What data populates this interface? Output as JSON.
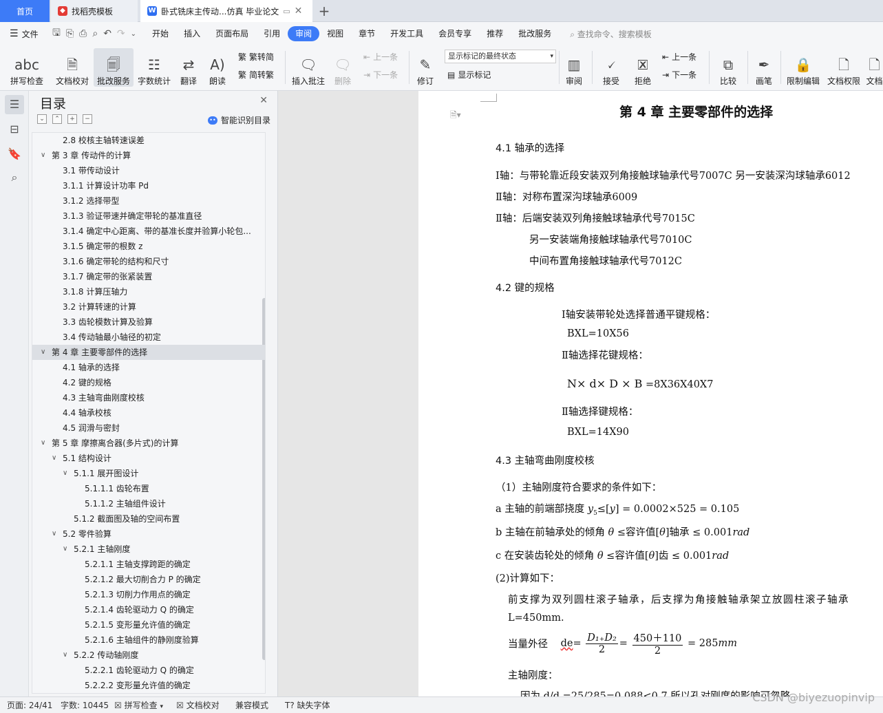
{
  "tabs": {
    "home": "首页",
    "templates": "找稻壳模板",
    "document": "卧式铣床主传动...仿真 毕业论文",
    "add": "+"
  },
  "menu": {
    "file": "文件",
    "items": [
      "开始",
      "插入",
      "页面布局",
      "引用",
      "审阅",
      "视图",
      "章节",
      "开发工具",
      "会员专享",
      "推荐",
      "批改服务"
    ],
    "active": "审阅",
    "search": "查找命令、搜索模板"
  },
  "ribbon": {
    "spellcheck": "拼写检查",
    "doc_proof": "文档校对",
    "correction_service": "批改服务",
    "word_count": "字数统计",
    "translate": "翻译",
    "read_aloud": "朗读",
    "trad_convert": "繁转简",
    "simp_convert": "简转繁",
    "insert_comment": "插入批注",
    "delete": "删除",
    "prev_comment": "上一条",
    "next_comment": "下一条",
    "revise": "修订",
    "markup_state": "显示标记的最终状态",
    "show_markup": "显示标记",
    "review": "审阅",
    "accept": "接受",
    "reject": "拒绝",
    "prev_change": "上一条",
    "next_change": "下一条",
    "compare": "比较",
    "ink": "画笔",
    "restrict_edit": "限制编辑",
    "doc_permission": "文档权限",
    "doc_more": "文档"
  },
  "toc": {
    "title": "目录",
    "smart_toc": "智能识别目录",
    "items": [
      {
        "text": "2.8 校核主轴转速误差",
        "level": 2,
        "chev": false
      },
      {
        "text": "第 3 章  传动件的计算",
        "level": 1,
        "chev": true
      },
      {
        "text": "3.1  带传动设计",
        "level": 2,
        "chev": false
      },
      {
        "text": "3.1.1 计算设计功率 Pd",
        "level": 2,
        "chev": false
      },
      {
        "text": "3.1.2 选择带型",
        "level": 2,
        "chev": false
      },
      {
        "text": "3.1.3 验证带速并确定带轮的基准直径",
        "level": 2,
        "chev": false
      },
      {
        "text": "3.1.4 确定中心距离、带的基准长度并验算小轮包...",
        "level": 2,
        "chev": false
      },
      {
        "text": "3.1.5 确定带的根数 z",
        "level": 2,
        "chev": false
      },
      {
        "text": "3.1.6 确定带轮的结构和尺寸",
        "level": 2,
        "chev": false
      },
      {
        "text": "3.1.7 确定带的张紧装置",
        "level": 2,
        "chev": false
      },
      {
        "text": "3.1.8 计算压轴力",
        "level": 2,
        "chev": false
      },
      {
        "text": "3.2  计算转速的计算",
        "level": 2,
        "chev": false
      },
      {
        "text": "3.3  齿轮模数计算及验算",
        "level": 2,
        "chev": false
      },
      {
        "text": "3.4  传动轴最小轴径的初定",
        "level": 2,
        "chev": false
      },
      {
        "text": "第 4 章  主要零部件的选择",
        "level": 1,
        "chev": true,
        "selected": true
      },
      {
        "text": "4.1  轴承的选择",
        "level": 2,
        "chev": false
      },
      {
        "text": "4.2  键的规格",
        "level": 2,
        "chev": false
      },
      {
        "text": "4.3  主轴弯曲刚度校核",
        "level": 2,
        "chev": false
      },
      {
        "text": "4.4  轴承校核",
        "level": 2,
        "chev": false
      },
      {
        "text": "4.5  润滑与密封",
        "level": 2,
        "chev": false
      },
      {
        "text": "第 5 章    摩擦离合器(多片式)的计算",
        "level": 1,
        "chev": true
      },
      {
        "text": "5.1  结构设计",
        "level": 2,
        "chev": true
      },
      {
        "text": "5.1.1  展开图设计",
        "level": 3,
        "chev": true
      },
      {
        "text": "5.1.1.1  齿轮布置",
        "level": 4,
        "chev": false
      },
      {
        "text": "5.1.1.2  主轴组件设计",
        "level": 4,
        "chev": false
      },
      {
        "text": "5.1.2  截面图及轴的空间布置",
        "level": 3,
        "chev": false
      },
      {
        "text": "5.2  零件验算",
        "level": 2,
        "chev": true
      },
      {
        "text": "5.2.1  主轴刚度",
        "level": 3,
        "chev": true
      },
      {
        "text": "5.2.1.1  主轴支撑跨距的确定",
        "level": 4,
        "chev": false
      },
      {
        "text": "5.2.1.2  最大切削合力 P 的确定",
        "level": 4,
        "chev": false
      },
      {
        "text": "5.2.1.3  切削力作用点的确定",
        "level": 4,
        "chev": false
      },
      {
        "text": "5.2.1.4  齿轮驱动力 Q 的确定",
        "level": 4,
        "chev": false
      },
      {
        "text": "5.2.1.5  变形量允许值的确定",
        "level": 4,
        "chev": false
      },
      {
        "text": "5.2.1.6  主轴组件的静刚度验算",
        "level": 4,
        "chev": false
      },
      {
        "text": "5.2.2  传动轴刚度",
        "level": 3,
        "chev": true
      },
      {
        "text": "5.2.2.1  齿轮驱动力 Q 的确定",
        "level": 4,
        "chev": false
      },
      {
        "text": "5.2.2.2  变形量允许值的确定",
        "level": 4,
        "chev": false
      }
    ]
  },
  "doc": {
    "chapter_title": "第 4 章  主要零部件的选择",
    "s41": "4.1  轴承的选择",
    "l1": "Ⅰ轴：与带轮靠近段安装双列角接触球轴承代号7007C  另一安装深沟球轴承6012",
    "l2": "Ⅱ轴：对称布置深沟球轴承6009",
    "l3": "Ⅱ轴：后端安装双列角接触球轴承代号7015C",
    "l4": "另一安装端角接触球轴承代号7010C",
    "l5": "中间布置角接触球轴承代号7012C",
    "s42": "4.2  键的规格",
    "k1": "Ⅰ轴安装带轮处选择普通平键规格：",
    "k2": "BXL=10X56",
    "k3": "Ⅱ轴选择花键规格：",
    "k4a": "N× d× D × B",
    "k4b": "=8X36X40X7",
    "k5": "Ⅱ轴选择键规格：",
    "k6": "BXL=14X90",
    "s43": "4.3  主轴弯曲刚度校核",
    "c1": "（1）主轴刚度符合要求的条件如下：",
    "c2a": "a 主轴的前端部挠度 ",
    "c2b": "y",
    "c2c": "≤[",
    "c2d": "y",
    "c2e": "] = 0.0002×525 = 0.105",
    "c3a": "b 主轴在前轴承处的倾角 ",
    "c3b": "θ",
    "c3c": " ≤容许值[",
    "c3d": "θ",
    "c3e": "]轴承 ≤ 0.001",
    "c3f": "rad",
    "c4a": "c 在安装齿轮处的倾角 ",
    "c4b": "θ",
    "c4c": " ≤容许值[",
    "c4d": "θ",
    "c4e": "]齿 ≤ 0.001",
    "c4f": "rad",
    "c5": "(2)计算如下：",
    "c6": "前支撑为双列圆柱滚子轴承，后支撑为角接触轴承架立放圆柱滚子轴承",
    "c7": "L=450mm.",
    "c8a": "当量外径",
    "c8b": "de",
    "c8c": "=",
    "c8num1": "D₁₊D₂",
    "c8den1": "2",
    "c8eq": "=",
    "c8num2": "450＋110",
    "c8den2": "2",
    "c8res": "= 285",
    "c8unit": "mm",
    "c9": "主轴刚度：",
    "c10": "因为 d/d =25/285=0.088<0.7 所以孔对刚度的影响可忽略"
  },
  "status": {
    "page": "页面: 24/41",
    "words": "字数: 10445",
    "spell": "拼写检查",
    "proof": "文档校对",
    "compat": "兼容模式",
    "missing_font": "缺失字体"
  },
  "watermark": "CSDN @biyezuopinvip",
  "colors": {
    "accent": "#3d7bf7",
    "tab_bar": "#dfe3ea"
  }
}
